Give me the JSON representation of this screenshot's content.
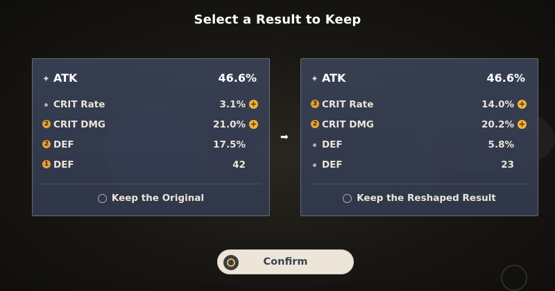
{
  "title": "Select a Result to Keep",
  "original": {
    "main_stat": {
      "name": "ATK",
      "value": "46.6%",
      "icon": "star-icon"
    },
    "substats": [
      {
        "marker": "dot",
        "name": "CRIT Rate",
        "value": "3.1%",
        "plus": true
      },
      {
        "marker": "2",
        "name": "CRIT DMG",
        "value": "21.0%",
        "plus": true
      },
      {
        "marker": "2",
        "name": "DEF",
        "value": "17.5%",
        "plus": false
      },
      {
        "marker": "1",
        "name": "DEF",
        "value": "42",
        "plus": false
      }
    ],
    "keep_label": "Keep the Original"
  },
  "reshaped": {
    "main_stat": {
      "name": "ATK",
      "value": "46.6%",
      "icon": "star-icon"
    },
    "substats": [
      {
        "marker": "3",
        "name": "CRIT Rate",
        "value": "14.0%",
        "plus": true
      },
      {
        "marker": "2",
        "name": "CRIT DMG",
        "value": "20.2%",
        "plus": true
      },
      {
        "marker": "dot",
        "name": "DEF",
        "value": "5.8%",
        "plus": false
      },
      {
        "marker": "dot",
        "name": "DEF",
        "value": "23",
        "plus": false
      }
    ],
    "keep_label": "Keep the Reshaped Result"
  },
  "arrow_icon": "arrow-right-icon",
  "confirm_label": "Confirm",
  "colors": {
    "panel": "#394256",
    "accent": "#e8a13a",
    "button": "#ece5d8",
    "button_text": "#3b4255"
  }
}
